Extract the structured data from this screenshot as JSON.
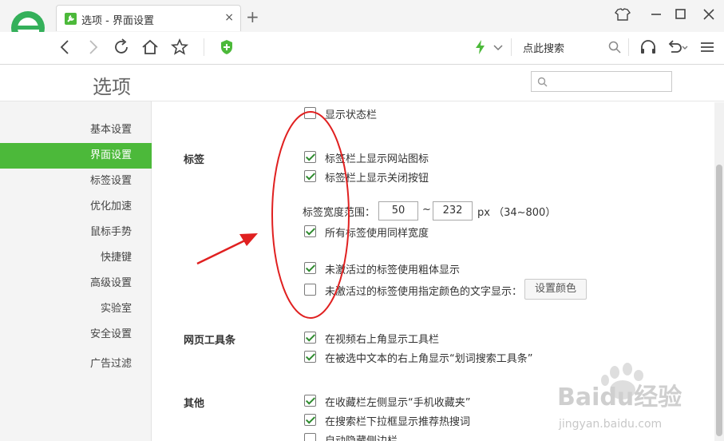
{
  "browser": {
    "tab_title": "选项 - 界面设置",
    "tab_close": "×",
    "new_tab": "+",
    "search_placeholder": "点此搜索"
  },
  "page": {
    "title": "选项",
    "search_value": ""
  },
  "sidebar": {
    "items": [
      {
        "label": "基本设置",
        "active": false
      },
      {
        "label": "界面设置",
        "active": true
      },
      {
        "label": "标签设置",
        "active": false
      },
      {
        "label": "优化加速",
        "active": false
      },
      {
        "label": "鼠标手势",
        "active": false
      },
      {
        "label": "快捷键",
        "active": false
      },
      {
        "label": "高级设置",
        "active": false
      },
      {
        "label": "实验室",
        "active": false
      },
      {
        "label": "安全设置",
        "active": false
      },
      {
        "label": "广告过滤",
        "active": false
      }
    ]
  },
  "content": {
    "status_bar": {
      "label": "显示状态栏",
      "checked": false
    },
    "tabs_section": {
      "title": "标签",
      "show_site_icon": {
        "label": "标签栏上显示网站图标",
        "checked": true
      },
      "show_close_button": {
        "label": "标签栏上显示关闭按钮",
        "checked": true
      },
      "width_label": "标签宽度范围：",
      "width_min": "50",
      "width_sep": "~",
      "width_max": "232",
      "width_unit": "px （34~800）",
      "same_width": {
        "label": "所有标签使用同样宽度",
        "checked": true
      },
      "bold_inactive": {
        "label": "未激活过的标签使用粗体显示",
        "checked": true
      },
      "color_inactive": {
        "label": "未激活过的标签使用指定颜色的文字显示：",
        "checked": false
      },
      "set_color_button": "设置颜色"
    },
    "toolbar_section": {
      "title": "网页工具条",
      "video_toolbar": {
        "label": "在视频右上角显示工具栏",
        "checked": true
      },
      "selection_toolbar": {
        "label": "在被选中文本的右上角显示“划词搜索工具条”",
        "checked": true
      }
    },
    "other_section": {
      "title": "其他",
      "mobile_favorites": {
        "label": "在收藏栏左侧显示“手机收藏夹”",
        "checked": true
      },
      "hot_search": {
        "label": "在搜索栏下拉框显示推荐热搜词",
        "checked": true
      },
      "auto_hide_sidebar": {
        "label": "自动隐藏侧边栏",
        "checked": false
      }
    }
  },
  "watermark": {
    "text": "Baidu经验",
    "url": "jingyan.baidu.com"
  },
  "colors": {
    "accent": "#4cb93a",
    "annotation": "#e02020",
    "checkmark": "#2e8b2e"
  }
}
